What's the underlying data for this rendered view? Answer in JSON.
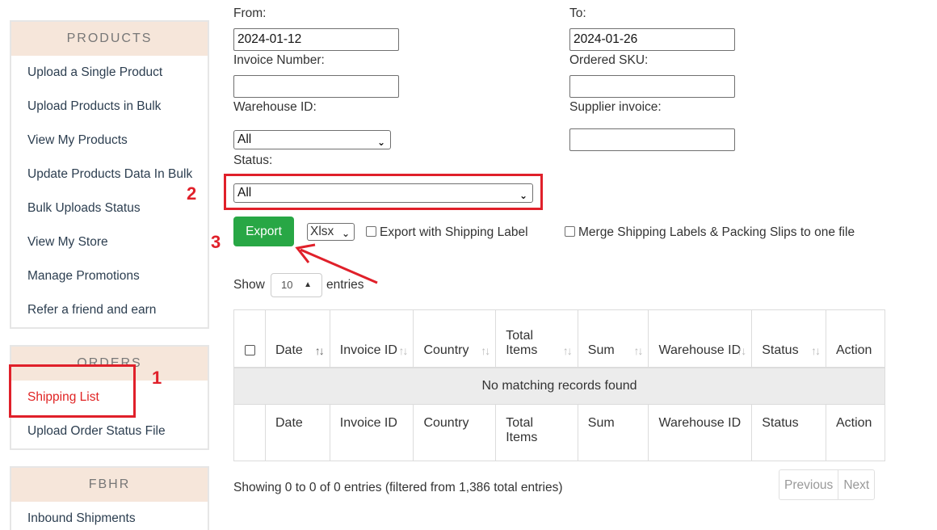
{
  "sidebar": {
    "products": {
      "title": "PRODUCTS",
      "items": [
        "Upload a Single Product",
        "Upload Products in Bulk",
        "View My Products",
        "Update Products Data In Bulk",
        "Bulk Uploads Status",
        "View My Store",
        "Manage Promotions",
        "Refer a friend and earn"
      ]
    },
    "orders": {
      "title": "ORDERS",
      "items": [
        "Shipping List",
        "Upload Order Status File"
      ]
    },
    "fbhr": {
      "title": "FBHR",
      "items": [
        "Inbound Shipments"
      ]
    }
  },
  "filters": {
    "from_label": "From:",
    "from_value": "2024-01-12",
    "to_label": "To:",
    "to_value": "2024-01-26",
    "invoice_label": "Invoice Number:",
    "invoice_value": "",
    "sku_label": "Ordered SKU:",
    "sku_value": "",
    "warehouse_label": "Warehouse ID:",
    "warehouse_value": "All",
    "supplier_label": "Supplier invoice:",
    "supplier_value": "",
    "status_label": "Status:",
    "status_value": "All"
  },
  "export": {
    "button": "Export",
    "format": "Xlsx",
    "with_label": "Export with Shipping Label",
    "merge": "Merge Shipping Labels & Packing Slips to one file"
  },
  "length": {
    "show": "Show",
    "value": "10",
    "entries": "entries"
  },
  "table": {
    "columns": [
      "Date",
      "Invoice ID",
      "Country",
      "Total Items",
      "Sum",
      "Warehouse ID",
      "Status",
      "Action"
    ],
    "empty": "No matching records found"
  },
  "info": "Showing 0 to 0 of 0 entries (filtered from 1,386 total entries)",
  "pagination": {
    "previous": "Previous",
    "next": "Next"
  },
  "annotations": {
    "n1": "1",
    "n2": "2",
    "n3": "3",
    "color": "#e0202a"
  }
}
